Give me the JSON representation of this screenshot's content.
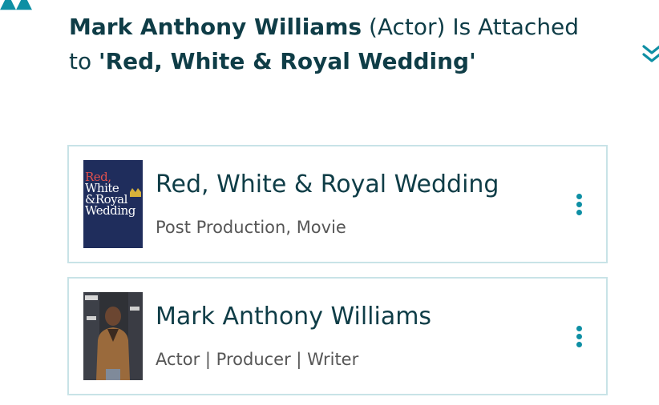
{
  "colors": {
    "accent": "#0e8fa4",
    "heading": "#0f3d47",
    "muted": "#565656",
    "border": "#c8e3e7"
  },
  "header": {
    "person": "Mark Anthony Williams",
    "role": "(Actor) Is",
    "attached_text": "Attached to",
    "project": "'Red, White & Royal Wedding'",
    "collapse_icon": "double-chevron-down-icon"
  },
  "cards": [
    {
      "title": "Red, White & Royal Wedding",
      "subtitle": "Post Production, Movie",
      "thumbnail": "movie-poster",
      "poster_lines": [
        "Red,",
        "White",
        "&Royal",
        "Wedding"
      ],
      "menu_icon": "more-vertical-icon"
    },
    {
      "title": "Mark Anthony Williams",
      "subtitle": "Actor | Producer | Writer",
      "thumbnail": "person-photo",
      "menu_icon": "more-vertical-icon"
    }
  ]
}
